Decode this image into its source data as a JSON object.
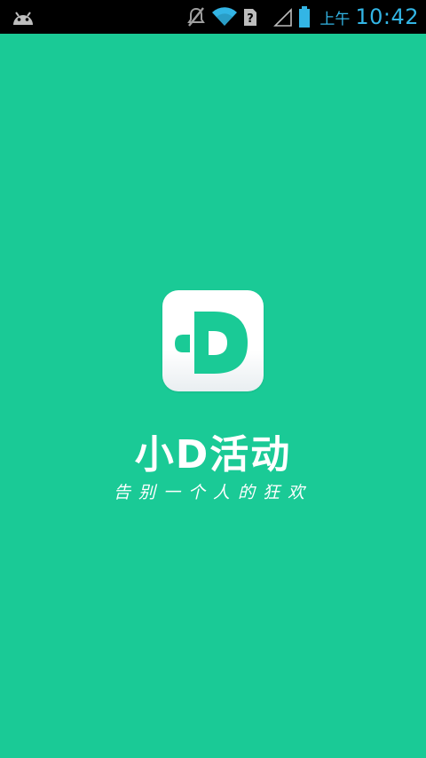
{
  "status_bar": {
    "ampm": "上午",
    "time": "10:42",
    "icons": [
      "android-icon",
      "mute-icon",
      "wifi-icon",
      "sim-unknown-icon",
      "signal-icon",
      "battery-icon"
    ]
  },
  "splash": {
    "app_name": "小D活动",
    "tagline": "告别一个人的狂欢",
    "logo_icon": "d-logo-icon"
  },
  "colors": {
    "background": "#1aca96",
    "status_bar": "#000000",
    "status_icons": "#33b5e5",
    "text": "#ffffff"
  }
}
